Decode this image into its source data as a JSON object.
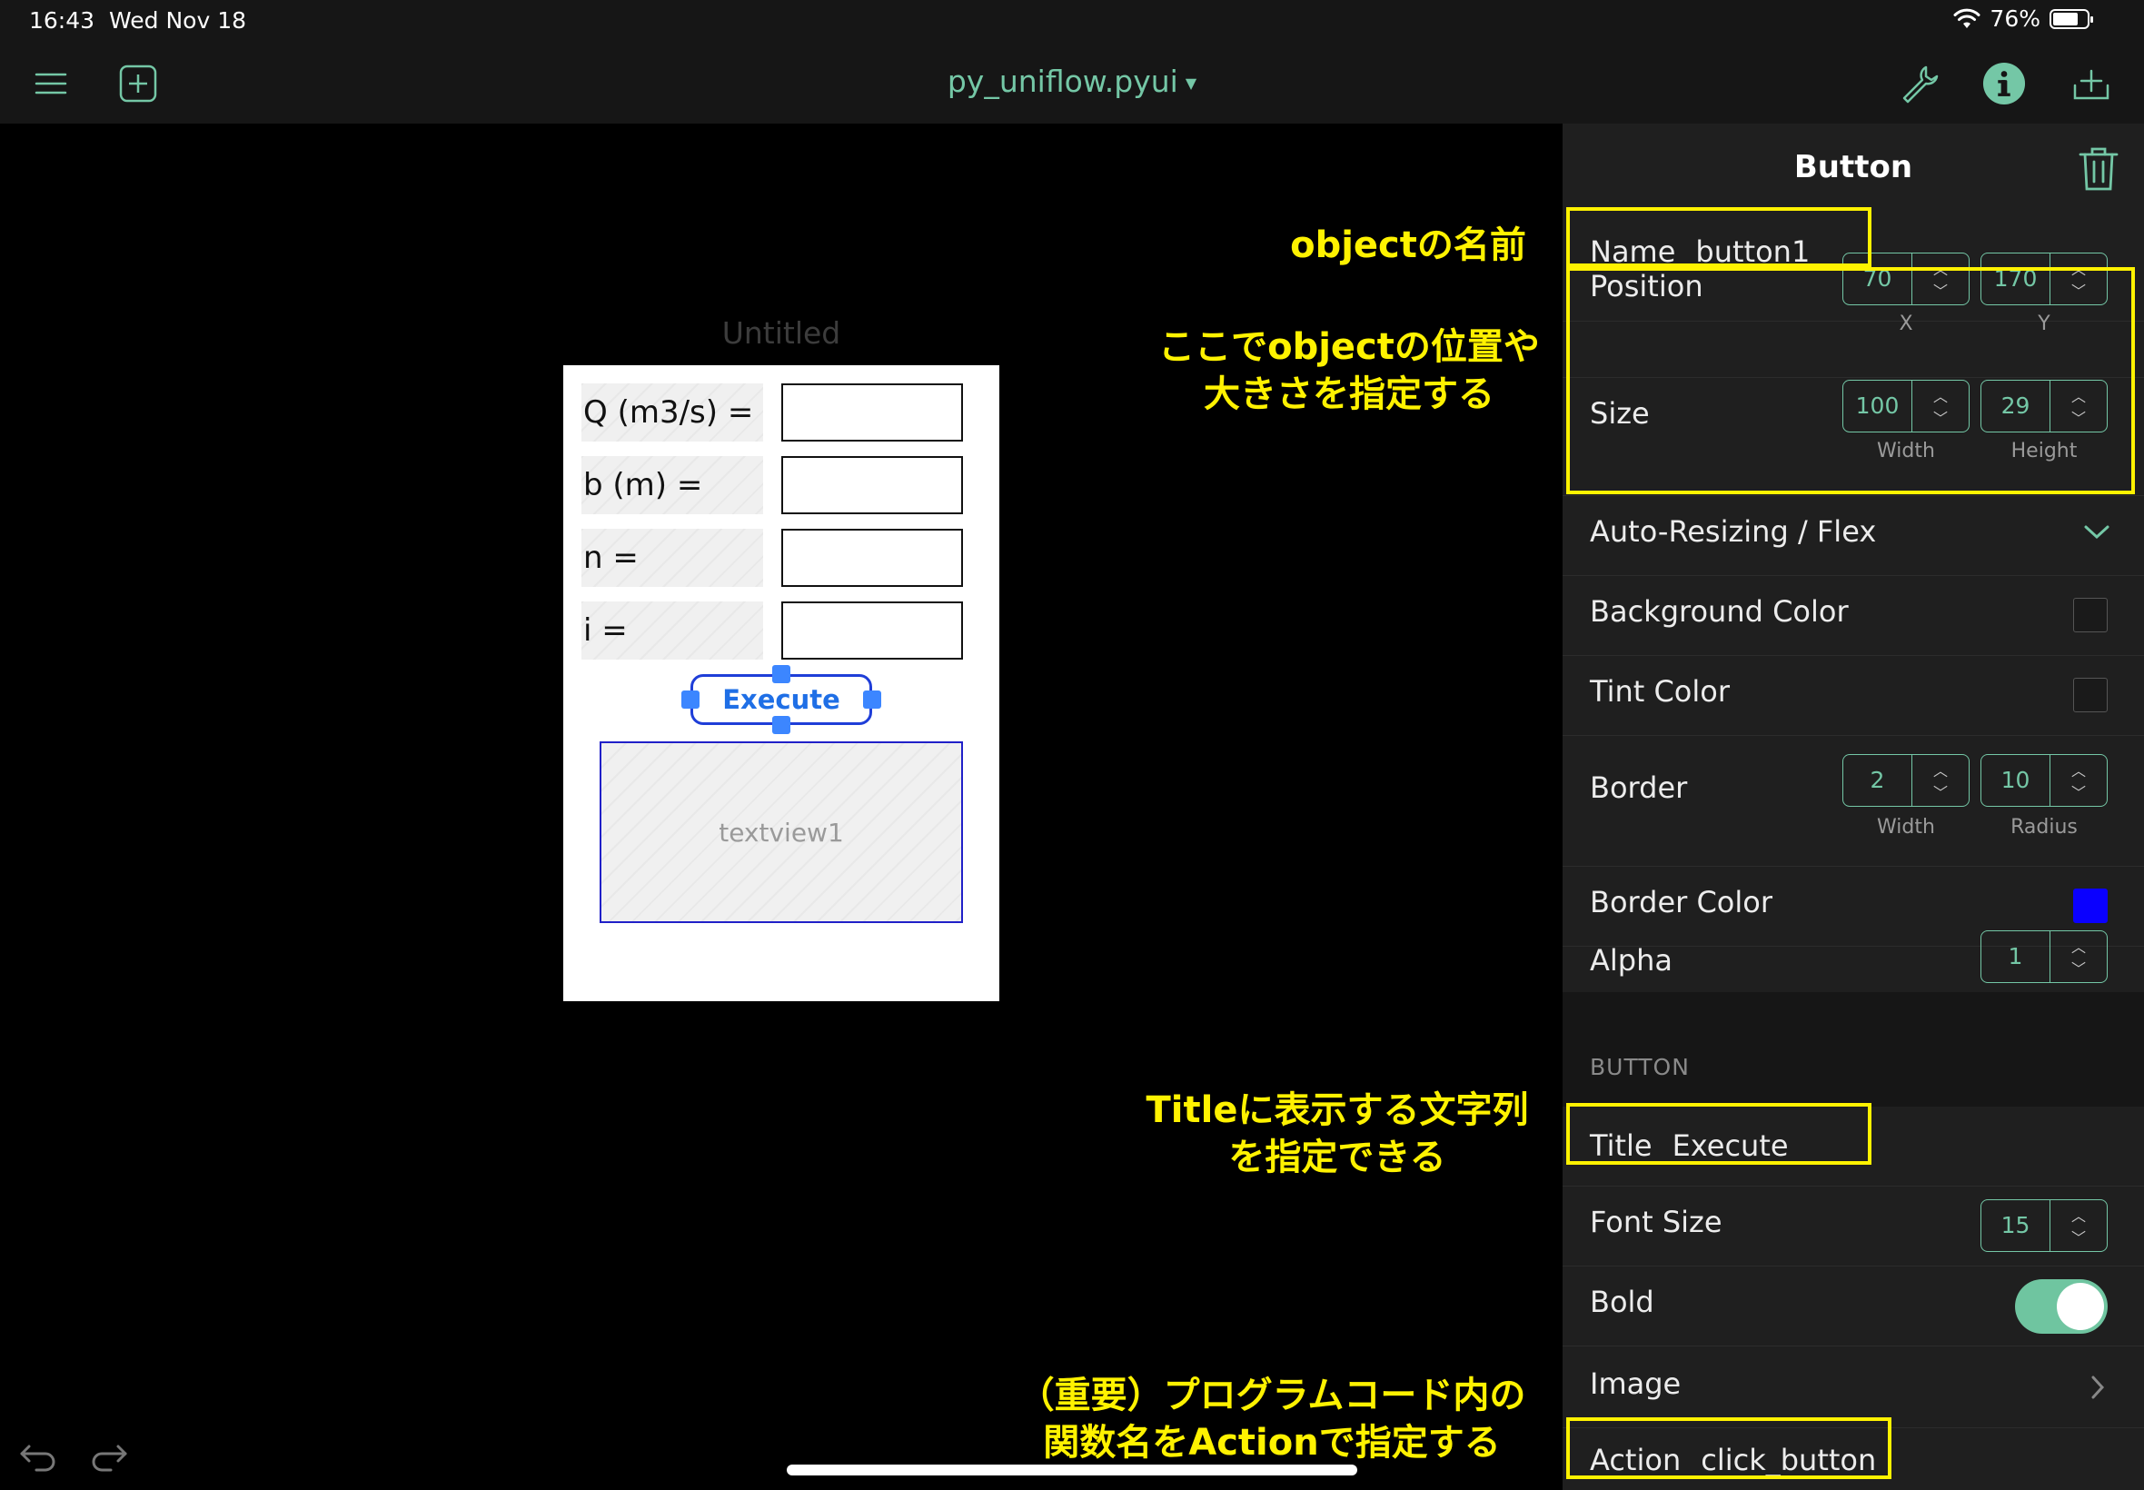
{
  "status_bar": {
    "time": "16:43",
    "date": "Wed Nov 18",
    "battery": "76%"
  },
  "nav": {
    "title": "py_uniflow.pyui"
  },
  "canvas": {
    "view_title": "Untitled",
    "rows": [
      {
        "label": "Q (m3/s) ="
      },
      {
        "label": "b (m) ="
      },
      {
        "label": "n ="
      },
      {
        "label": "i ="
      }
    ],
    "button_title": "Execute",
    "textview_placeholder": "textview1"
  },
  "annotations": {
    "name": "objectの名前",
    "frame_line1": "ここでobjectの位置や",
    "frame_line2": "大きさを指定する",
    "title_line1": "Titleに表示する文字列",
    "title_line2": "を指定できる",
    "action_line1": "（重要）プログラムコード内の",
    "action_line2": "関数名をActionで指定する"
  },
  "inspector": {
    "title": "Button",
    "name_label": "Name",
    "name_value": "button1",
    "position_label": "Position",
    "position_x": "70",
    "position_y": "170",
    "x_label": "X",
    "y_label": "Y",
    "size_label": "Size",
    "size_width": "100",
    "size_height": "29",
    "width_label": "Width",
    "height_label": "Height",
    "autoresize_label": "Auto-Resizing / Flex",
    "background_color_label": "Background Color",
    "tint_color_label": "Tint Color",
    "border_label": "Border",
    "border_width": "2",
    "border_radius": "10",
    "border_width_label": "Width",
    "border_radius_label": "Radius",
    "border_color_label": "Border Color",
    "border_color": "#0a00ff",
    "alpha_label": "Alpha",
    "alpha_value": "1",
    "section_button": "BUTTON",
    "title_label": "Title",
    "title_value": "Execute",
    "font_size_label": "Font Size",
    "font_size_value": "15",
    "bold_label": "Bold",
    "bold_on": true,
    "image_label": "Image",
    "action_label": "Action",
    "action_value": "click_button"
  },
  "colors": {
    "accent": "#74c7a6",
    "annotation": "#fff200",
    "selection": "#3c86ff"
  }
}
